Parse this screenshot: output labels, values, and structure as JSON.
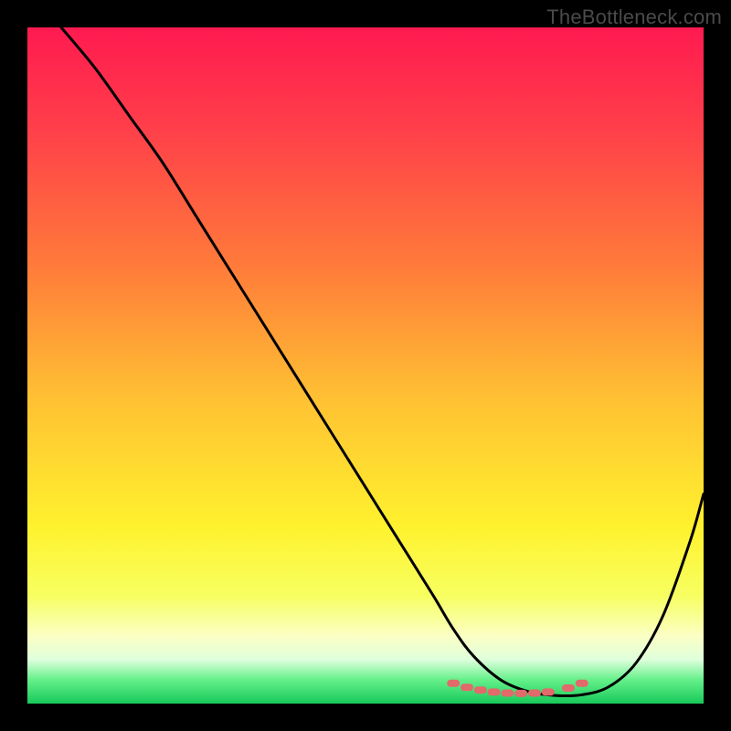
{
  "watermark": "TheBottleneck.com",
  "chart_data": {
    "type": "line",
    "title": "",
    "xlabel": "",
    "ylabel": "",
    "xlim": [
      0,
      100
    ],
    "ylim": [
      0,
      100
    ],
    "series": [
      {
        "name": "curve",
        "x": [
          5,
          10,
          15,
          20,
          25,
          30,
          35,
          40,
          45,
          50,
          55,
          60,
          63,
          66,
          70,
          74,
          78,
          82,
          86,
          90,
          94,
          98,
          100
        ],
        "y": [
          100,
          94,
          87,
          80,
          72,
          64,
          56,
          48,
          40,
          32,
          24,
          16,
          11,
          7,
          3.5,
          1.8,
          1.2,
          1.3,
          2.5,
          6,
          13,
          24,
          31
        ]
      }
    ],
    "markers": {
      "name": "highlight-dots",
      "color": "#e16a6a",
      "x": [
        63,
        65,
        67,
        69,
        71,
        73,
        75,
        77,
        80,
        82
      ],
      "y": [
        3.0,
        2.4,
        2.0,
        1.7,
        1.55,
        1.5,
        1.55,
        1.7,
        2.3,
        3.0
      ]
    },
    "gradient_stops": [
      {
        "offset": 0.0,
        "color": "#ff1a50"
      },
      {
        "offset": 0.15,
        "color": "#ff3f4a"
      },
      {
        "offset": 0.35,
        "color": "#ff7a3a"
      },
      {
        "offset": 0.55,
        "color": "#ffc133"
      },
      {
        "offset": 0.74,
        "color": "#fff22e"
      },
      {
        "offset": 0.84,
        "color": "#f7ff60"
      },
      {
        "offset": 0.9,
        "color": "#fbffc4"
      },
      {
        "offset": 0.935,
        "color": "#dfffdc"
      },
      {
        "offset": 0.965,
        "color": "#64f08a"
      },
      {
        "offset": 1.0,
        "color": "#18c95a"
      }
    ]
  }
}
